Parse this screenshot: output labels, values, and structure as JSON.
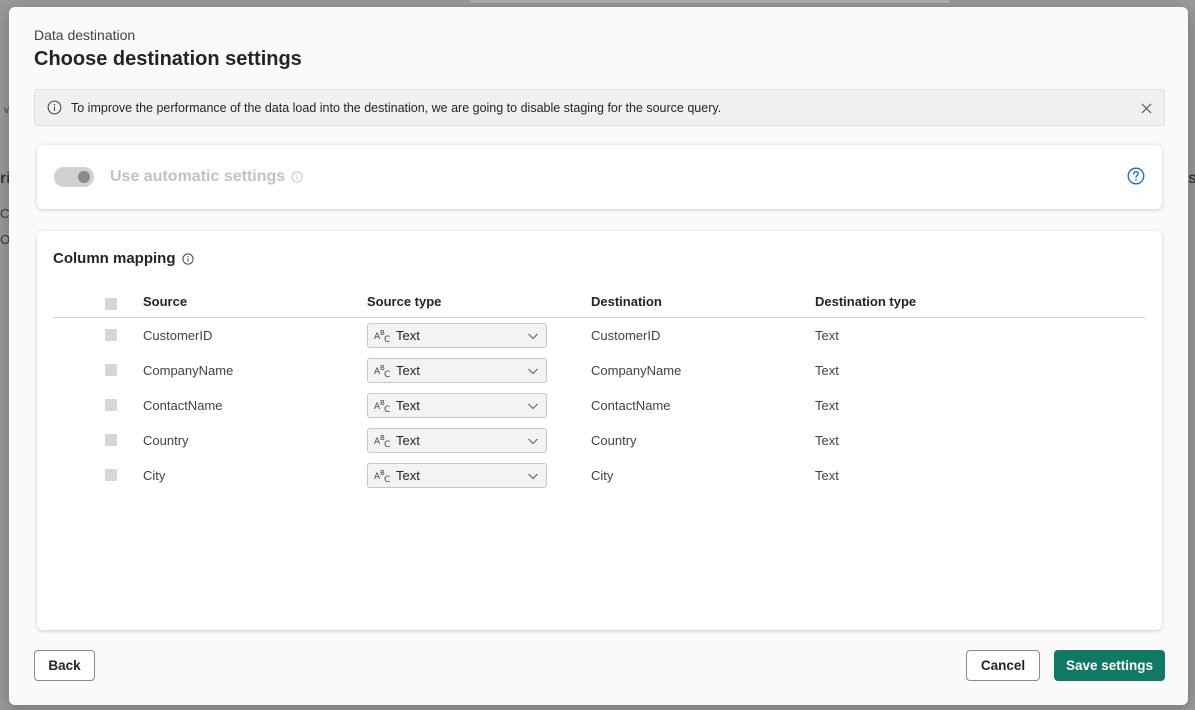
{
  "background": {
    "fragments": [
      "v",
      "ri",
      "C",
      "O",
      "s"
    ]
  },
  "dialog": {
    "eyebrow": "Data destination",
    "title": "Choose destination settings"
  },
  "banner": {
    "message": "To improve the performance of the data load into the destination, we are going to disable staging for the source query.",
    "info_icon": "info-icon",
    "close_icon": "close-icon"
  },
  "auto_settings": {
    "label": "Use automatic settings",
    "enabled": true,
    "disabled_state": true
  },
  "column_mapping": {
    "title": "Column mapping",
    "headers": {
      "source": "Source",
      "source_type": "Source type",
      "destination": "Destination",
      "destination_type": "Destination type"
    },
    "rows": [
      {
        "source": "CustomerID",
        "source_type": "Text",
        "destination": "CustomerID",
        "destination_type": "Text"
      },
      {
        "source": "CompanyName",
        "source_type": "Text",
        "destination": "CompanyName",
        "destination_type": "Text"
      },
      {
        "source": "ContactName",
        "source_type": "Text",
        "destination": "ContactName",
        "destination_type": "Text"
      },
      {
        "source": "Country",
        "source_type": "Text",
        "destination": "Country",
        "destination_type": "Text"
      },
      {
        "source": "City",
        "source_type": "Text",
        "destination": "City",
        "destination_type": "Text"
      }
    ]
  },
  "footer": {
    "back_label": "Back",
    "cancel_label": "Cancel",
    "save_label": "Save settings"
  },
  "colors": {
    "primary": "#117865",
    "overlay": "#9a9a9a"
  }
}
